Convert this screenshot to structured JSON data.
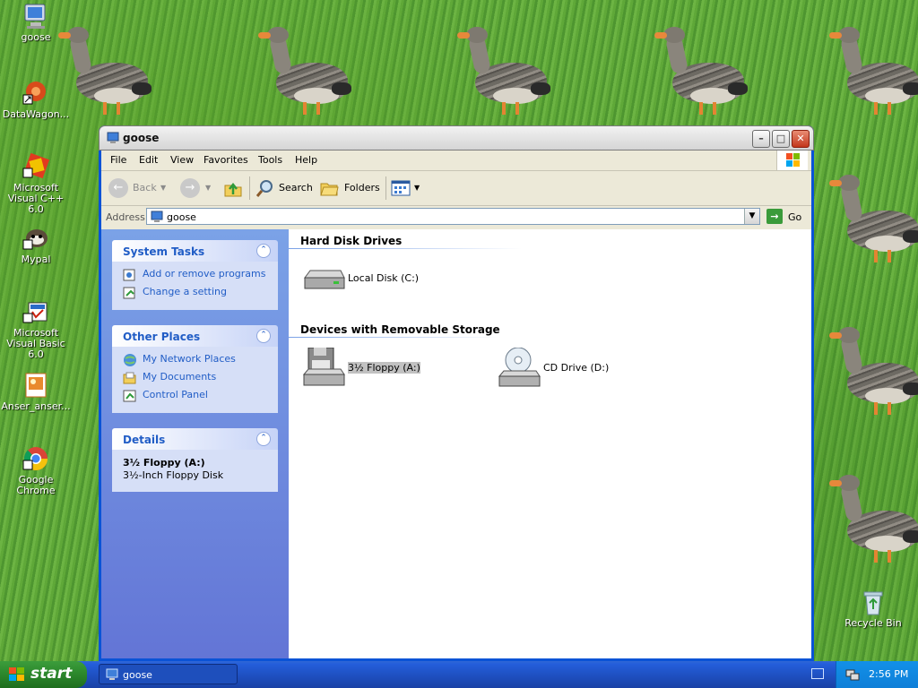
{
  "desktop": {
    "icons": [
      {
        "label": "goose",
        "icon": "computer-icon"
      },
      {
        "label": "DataWagon...",
        "icon": "datawagon-icon"
      },
      {
        "label": "Microsoft Visual C++ 6.0",
        "icon": "visual-cpp-icon"
      },
      {
        "label": "Mypal",
        "icon": "mypal-icon"
      },
      {
        "label": "Microsoft Visual Basic 6.0",
        "icon": "visual-basic-icon"
      },
      {
        "label": "Anser_anser...",
        "icon": "image-file-icon"
      },
      {
        "label": "Google Chrome",
        "icon": "chrome-icon"
      },
      {
        "label": "Recycle Bin",
        "icon": "recycle-bin-icon"
      }
    ]
  },
  "window": {
    "title": "goose",
    "menu": [
      "File",
      "Edit",
      "View",
      "Favorites",
      "Tools",
      "Help"
    ],
    "toolbar": {
      "back": "Back",
      "search": "Search",
      "folders": "Folders"
    },
    "address": {
      "label": "Address",
      "value": "goose",
      "go": "Go"
    },
    "taskpane": {
      "system_tasks": {
        "title": "System Tasks",
        "links": [
          "Add or remove programs",
          "Change a setting"
        ]
      },
      "other_places": {
        "title": "Other Places",
        "links": [
          "My Network Places",
          "My Documents",
          "Control Panel"
        ]
      },
      "details": {
        "title": "Details",
        "name": "3½ Floppy (A:)",
        "desc": "3½-Inch Floppy Disk"
      }
    },
    "groups": {
      "hard_disks": {
        "title": "Hard Disk Drives",
        "items": [
          "Local Disk (C:)"
        ]
      },
      "removable": {
        "title": "Devices with Removable Storage",
        "items": [
          "3½ Floppy (A:)",
          "CD Drive (D:)"
        ]
      }
    }
  },
  "taskbar": {
    "start": "start",
    "task": "goose",
    "clock": "2:56 PM"
  },
  "colors": {
    "titlebar": "#e1e1e1",
    "taskbar": "#245edb",
    "start": "#2e8b2e",
    "taskpane": "#6f8fde",
    "link": "#215dc6"
  }
}
